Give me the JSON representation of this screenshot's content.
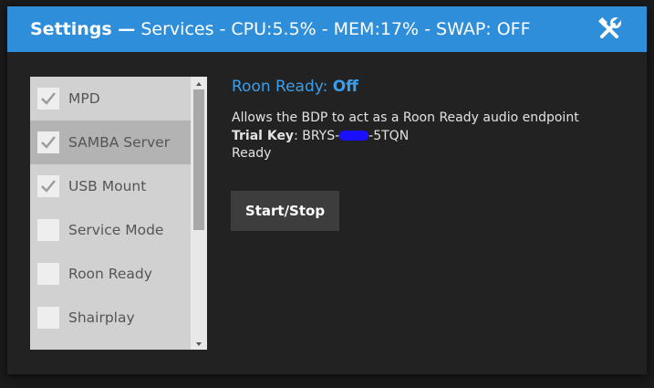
{
  "titlebar": {
    "title_bold": "Settings —",
    "status": "Services - CPU:5.5% - MEM:17% - SWAP: OFF",
    "close_icon": "wrench-screwdriver-icon"
  },
  "services": [
    {
      "label": "MPD",
      "checked": true
    },
    {
      "label": "SAMBA Server",
      "checked": true,
      "selected": true
    },
    {
      "label": "USB Mount",
      "checked": true
    },
    {
      "label": "Service Mode",
      "checked": false
    },
    {
      "label": "Roon Ready",
      "checked": false
    },
    {
      "label": "Shairplay",
      "checked": false
    }
  ],
  "detail": {
    "name": "Roon Ready:",
    "state": "Off",
    "description": "Allows the BDP to act as a Roon Ready audio endpoint",
    "trial_key_label": "Trial Key",
    "trial_key_prefix": "BRYS-",
    "trial_key_suffix": "-5TQN",
    "status": "Ready"
  },
  "actions": {
    "start_stop_label": "Start/Stop"
  },
  "colors": {
    "titlebar": "#2f8ed9",
    "accent_text": "#3b9eeb",
    "redaction": "#1a10ff"
  }
}
